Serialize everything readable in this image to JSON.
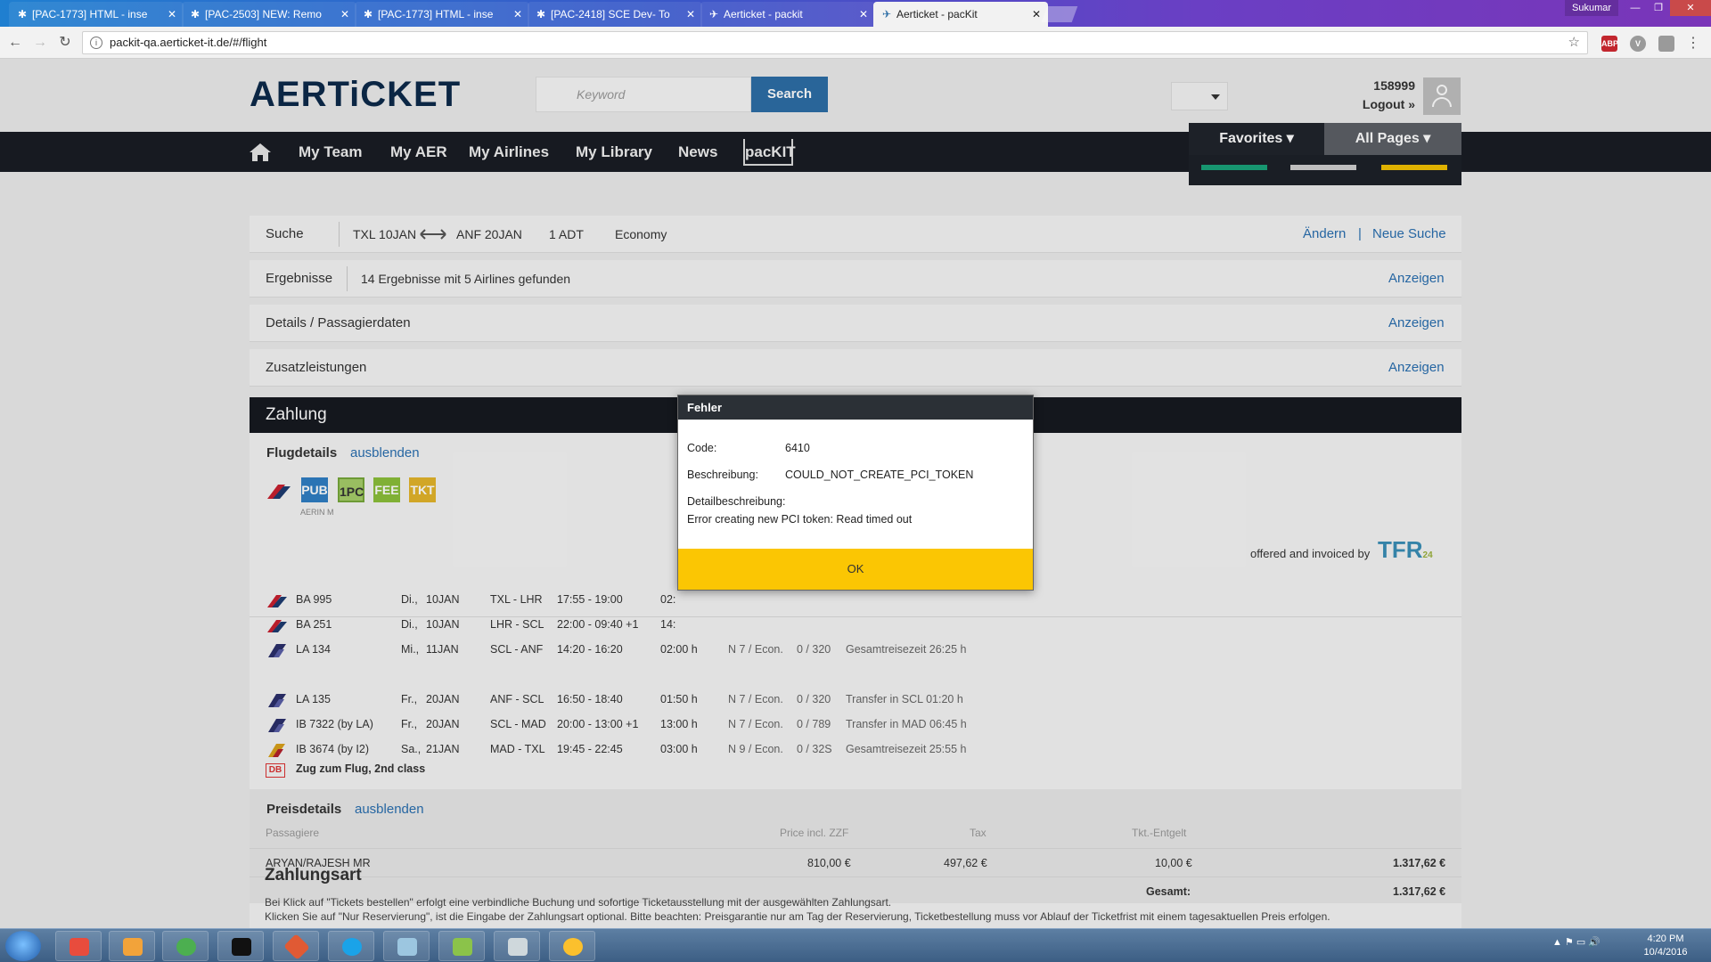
{
  "browser": {
    "tabs": [
      {
        "label": "[PAC-1773] HTML - inse",
        "active": false
      },
      {
        "label": "[PAC-2503] NEW: Remo",
        "active": false
      },
      {
        "label": "[PAC-1773] HTML - inse",
        "active": false
      },
      {
        "label": "[PAC-2418] SCE Dev- To",
        "active": false
      },
      {
        "label": "Aerticket - packit",
        "active": false
      },
      {
        "label": "Aerticket - pacKit",
        "active": true
      }
    ],
    "window_user": "Sukumar",
    "url": "packit-qa.aerticket-it.de/#/flight",
    "extensions": [
      "ABP",
      "V",
      ""
    ]
  },
  "header": {
    "logo": "AERTiCKET",
    "search_placeholder": "Keyword",
    "search_button": "Search",
    "user_id": "158999",
    "logout": "Logout »"
  },
  "nav": {
    "items": [
      "My Team",
      "My AER",
      "My Airlines",
      "My Library",
      "News"
    ],
    "packit": "pacKIT",
    "favorites": "Favorites",
    "all_pages": "All Pages",
    "fav_bar_colors": [
      "#1aa37a",
      "#cfcfcf",
      "#f2c100"
    ]
  },
  "search_panel": {
    "label": "Suche",
    "from": "TXL 10JAN",
    "to": "ANF 20JAN",
    "pax": "1 ADT",
    "cabin": "Economy",
    "change": "Ändern",
    "pipe": "|",
    "new_search": "Neue Suche"
  },
  "results_panel": {
    "label": "Ergebnisse",
    "summary": "14 Ergebnisse mit 5 Airlines gefunden",
    "link": "Anzeigen"
  },
  "details_panel": {
    "label": "Details / Passagierdaten",
    "link": "Anzeigen"
  },
  "extras_panel": {
    "label": "Zusatzleistungen",
    "link": "Anzeigen"
  },
  "payment": {
    "title": "Zahlung",
    "flight_details_title": "Flugdetails",
    "hide": "ausblenden",
    "badges": [
      {
        "text": "PUB",
        "color": "#2f7ec4"
      },
      {
        "text": "1PC",
        "color": "#77a83a"
      },
      {
        "text": "FEE",
        "color": "#8bbf3a"
      },
      {
        "text": "TKT",
        "color": "#e3b52b"
      }
    ],
    "aer_small": "AERIN M",
    "offered_by": "offered and invoiced by",
    "tfr": "TFR",
    "tfr_sub": "24",
    "outbound": [
      {
        "flight": "BA 995",
        "day": "Di.,",
        "date": "10JAN",
        "route": "TXL - LHR",
        "time": "17:55 - 19:00",
        "dur": "02:",
        "cls": "",
        "seats": "",
        "note": ""
      },
      {
        "flight": "BA 251",
        "day": "Di.,",
        "date": "10JAN",
        "route": "LHR - SCL",
        "time": "22:00 - 09:40 +1",
        "dur": "14:",
        "cls": "",
        "seats": "",
        "note": ""
      },
      {
        "flight": "LA 134",
        "day": "Mi.,",
        "date": "11JAN",
        "route": "SCL - ANF",
        "time": "14:20 - 16:20",
        "dur": "02:00 h",
        "cls": "N 7 / Econ.",
        "seats": "0 / 320",
        "note": "Gesamtreisezeit 26:25 h"
      }
    ],
    "inbound": [
      {
        "flight": "LA 135",
        "day": "Fr.,",
        "date": "20JAN",
        "route": "ANF - SCL",
        "time": "16:50 - 18:40",
        "dur": "01:50 h",
        "cls": "N 7 / Econ.",
        "seats": "0 / 320",
        "note": "Transfer in SCL 01:20 h"
      },
      {
        "flight": "IB 7322 (by LA)",
        "day": "Fr.,",
        "date": "20JAN",
        "route": "SCL - MAD",
        "time": "20:00 - 13:00 +1",
        "dur": "13:00 h",
        "cls": "N 7 / Econ.",
        "seats": "0 / 789",
        "note": "Transfer in MAD 06:45 h"
      },
      {
        "flight": "IB 3674 (by I2)",
        "day": "Sa.,",
        "date": "21JAN",
        "route": "MAD - TXL",
        "time": "19:45 - 22:45",
        "dur": "03:00 h",
        "cls": "N 9 / Econ.",
        "seats": "0 / 32S",
        "note": "Gesamtreisezeit 25:55 h"
      }
    ],
    "train_icon": "DB",
    "train": "Zug zum Flug,  2nd class",
    "price_title": "Preisdetails",
    "price_headers": {
      "passengers": "Passagiere",
      "price": "Price incl. ZZF",
      "tax": "Tax",
      "fee": "Tkt.-Entgelt"
    },
    "price_row": {
      "name": "ARYAN/RAJESH MR",
      "price": "810,00 €",
      "tax": "497,62 €",
      "fee": "10,00 €",
      "total": "1.317,62 €"
    },
    "total_label": "Gesamt:",
    "total_value": "1.317,62 €",
    "method_title": "Zahlungsart",
    "hint1": "Bei Klick auf \"Tickets bestellen\" erfolgt eine verbindliche Buchung und sofortige Ticketausstellung mit der ausgewählten Zahlungsart.",
    "hint2": "Klicken Sie auf \"Nur Reservierung\", ist die Eingabe der Zahlungsart optional. Bitte beachten: Preisgarantie nur am Tag der Reservierung, Ticketbestellung muss vor Ablauf der Ticketfrist mit einem tagesaktuellen Preis erfolgen."
  },
  "dialog": {
    "title": "Fehler",
    "code_label": "Code:",
    "code": "6410",
    "desc_label": "Beschreibung:",
    "desc": "COULD_NOT_CREATE_PCI_TOKEN",
    "detail_label": "Detailbeschreibung:",
    "detail": "Error creating new PCI token: Read timed out",
    "ok": "OK",
    "ok_color": "#fbc603"
  },
  "taskbar": {
    "time": "4:20 PM",
    "date": "10/4/2016"
  }
}
